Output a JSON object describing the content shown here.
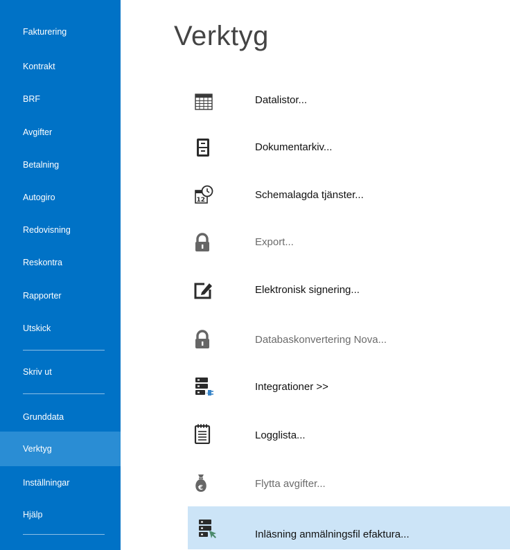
{
  "sidebar": {
    "items": [
      {
        "label": "Fakturering"
      },
      {
        "label": "Kontrakt"
      },
      {
        "label": "BRF"
      },
      {
        "label": "Avgifter"
      },
      {
        "label": "Betalning"
      },
      {
        "label": "Autogiro"
      },
      {
        "label": "Redovisning"
      },
      {
        "label": "Reskontra"
      },
      {
        "label": "Rapporter"
      },
      {
        "label": "Utskick"
      },
      {
        "label": "Skriv ut"
      },
      {
        "label": "Grunddata"
      },
      {
        "label": "Verktyg",
        "active": true
      },
      {
        "label": "Inställningar"
      },
      {
        "label": "Hjälp"
      }
    ]
  },
  "main": {
    "title": "Verktyg",
    "tools": [
      {
        "label": "Datalistor...",
        "icon": "table-grid-icon",
        "enabled": true
      },
      {
        "label": "Dokumentarkiv...",
        "icon": "file-cabinet-icon",
        "enabled": true
      },
      {
        "label": "Schemalagda tjänster...",
        "icon": "calendar-clock-icon",
        "enabled": true
      },
      {
        "label": "Export...",
        "icon": "lock-icon",
        "enabled": false
      },
      {
        "label": "Elektronisk signering...",
        "icon": "sign-pen-icon",
        "enabled": true
      },
      {
        "label": "Databaskonvertering Nova...",
        "icon": "lock-icon",
        "enabled": false
      },
      {
        "label": "Integrationer >>",
        "icon": "server-plug-icon",
        "enabled": true
      },
      {
        "label": "Logglista...",
        "icon": "notepad-icon",
        "enabled": true
      },
      {
        "label": "Flytta avgifter...",
        "icon": "money-bag-euro-icon",
        "enabled": false
      },
      {
        "label": "Inläsning anmälningsfil efaktura...",
        "icon": "server-arrow-icon",
        "enabled": true,
        "selected": true
      }
    ]
  },
  "colors": {
    "sidebar_bg": "#0072c6",
    "sidebar_active": "#2a8dd4",
    "selected_row": "#cce4f7",
    "icon_dark": "#2b2b2b",
    "icon_disabled": "#666666",
    "accent_blue": "#3a86c8",
    "accent_green": "#4b8a6b"
  }
}
